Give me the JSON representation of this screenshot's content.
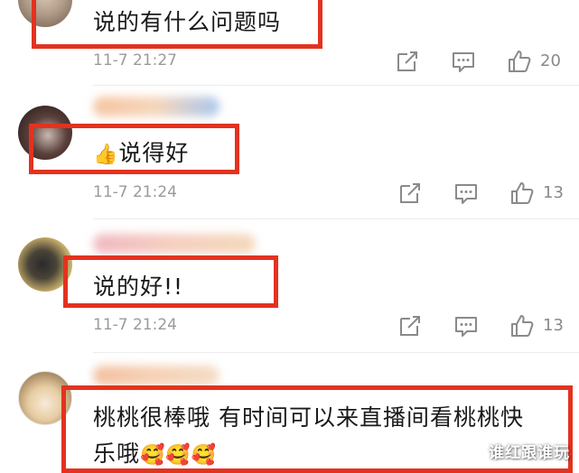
{
  "comments": [
    {
      "text": "说的有什么问题吗",
      "timestamp": "11-7 21:27",
      "like_count": "20"
    },
    {
      "emoji": "👍",
      "text": "说得好",
      "timestamp": "11-7 21:24",
      "like_count": "13"
    },
    {
      "text": "说的好!!",
      "timestamp": "11-7 21:24",
      "like_count": "13"
    },
    {
      "text_line1": "桃桃很棒哦 有时间可以来直播间看桃桃快",
      "text_line2": "乐哦",
      "emojis": "🥰🥰🥰"
    }
  ],
  "icons": {
    "share": "share-icon",
    "reply": "comment-icon",
    "like": "thumbs-up-icon"
  },
  "colors": {
    "highlight": "#e3321f",
    "meta_text": "#9a9a9a",
    "body_text": "#1a1a1a"
  },
  "watermark": "谁红跟谁玩"
}
